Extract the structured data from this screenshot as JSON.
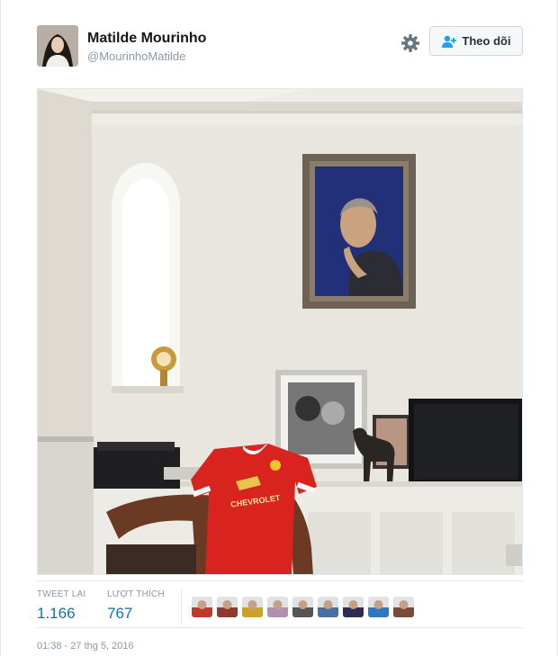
{
  "tweet": {
    "author": {
      "name": "Matilde Mourinho",
      "handle": "@MourinhoMatilde"
    },
    "follow_button": {
      "label": "Theo dõi"
    },
    "photo": {
      "jersey_sponsor": "CHEVROLET"
    },
    "stats": {
      "retweets_label": "TWEET LẠI",
      "retweets_count": "1.166",
      "likes_label": "LƯỢT THÍCH",
      "likes_count": "767",
      "likers": [
        {
          "color": "#c0392b"
        },
        {
          "color": "#8e3a2f"
        },
        {
          "color": "#c9a227"
        },
        {
          "color": "#b08fb0"
        },
        {
          "color": "#555555"
        },
        {
          "color": "#4a6fa5"
        },
        {
          "color": "#2c2c54"
        },
        {
          "color": "#2b78c5"
        },
        {
          "color": "#7b4b3a"
        }
      ]
    },
    "timestamp": "01:38 - 27 thg 5, 2016"
  },
  "colors": {
    "link_blue": "#1a6fa8",
    "muted_text": "#8899a6",
    "wall": "#e9e6df",
    "jersey_red": "#d8231e"
  },
  "icons": {
    "settings": "gear-icon",
    "follow": "add-user-icon"
  }
}
